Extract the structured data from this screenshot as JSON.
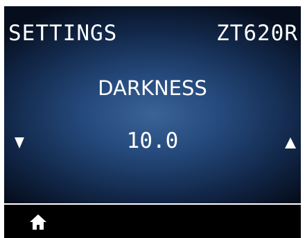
{
  "header": {
    "title": "SETTINGS",
    "model": "ZT620R"
  },
  "setting": {
    "name": "DARKNESS",
    "value": "10.0"
  },
  "controls": {
    "decrease_icon": "down-triangle",
    "increase_icon": "up-triangle",
    "home_icon": "home"
  },
  "colors": {
    "screen_gradient_center": "#3b6397",
    "screen_gradient_edge": "#060e1e",
    "text": "#ffffff",
    "footer_background": "#000000"
  }
}
